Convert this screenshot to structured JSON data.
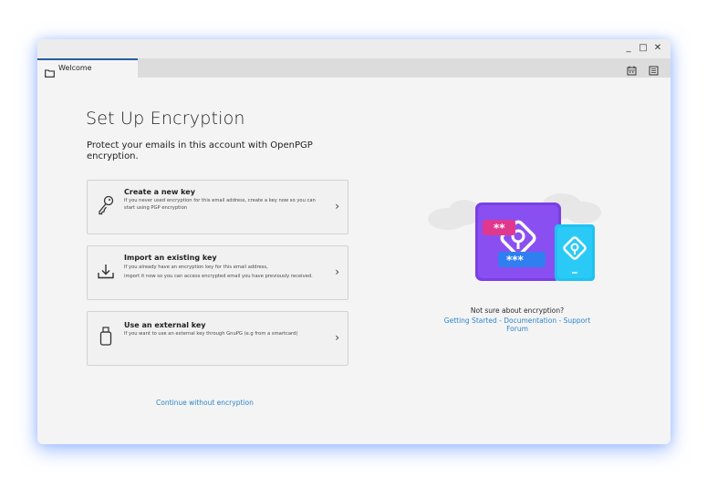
{
  "window": {
    "controls": {
      "minimize": "_",
      "maximize": "□",
      "close": "✕"
    }
  },
  "tab": {
    "label": "Welcome",
    "icon": "folder-icon"
  },
  "toolbar_icons": [
    "calendar-icon",
    "address-book-icon"
  ],
  "heading": "Set Up Encryption",
  "subtitle": "Protect your emails in this account with OpenPGP encryption.",
  "cards": [
    {
      "title": "Create a new key",
      "desc": "If you never used encryption for this email address, create a key now so you can start using PGP encryption",
      "icon": "key-icon"
    },
    {
      "title": "Import  an existing key",
      "desc1": "If you already have an encryption key for this email address,",
      "desc2": "import it now so you can access encrypted email you have previously received.",
      "icon": "import-icon"
    },
    {
      "title": "Use an external key",
      "desc": "If you want to use an external key through GnuPG (e.g from a smartcard)",
      "icon": "usb-key-icon"
    }
  ],
  "continue_link": "Continue without encryption",
  "help": {
    "question": "Not sure about encryption?",
    "links": [
      "Getting Started",
      "Documentation",
      "Support Forum"
    ],
    "separator": " - "
  },
  "illustration": {
    "badge_pink": "**",
    "badge_blue": "***",
    "colors": {
      "purple": "#7b3fe4",
      "cyan": "#1ec1f2",
      "pink": "#e0388f",
      "blue": "#2f7ff0"
    }
  }
}
